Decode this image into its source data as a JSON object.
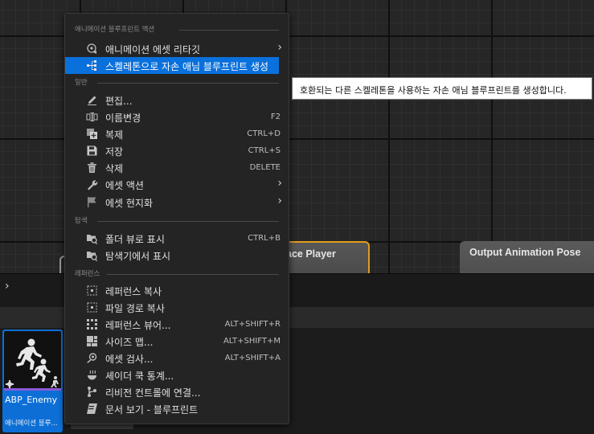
{
  "graph": {
    "nodes": [
      {
        "id": "player",
        "title": "ace Player"
      },
      {
        "id": "output",
        "title": "Output Animation Pose"
      }
    ]
  },
  "breadcrumb": {
    "arrow": "›"
  },
  "asset": {
    "name": "ABP_Enemy",
    "type": "애니메이션 블루...",
    "accent": "#0d6fd6",
    "type_color": "#8a5ad8"
  },
  "context_menu": {
    "sections": [
      {
        "header": "애니메이션 블루프린트 액션"
      },
      {
        "header": "일반"
      },
      {
        "header": "탐색"
      },
      {
        "header": "레퍼런스"
      }
    ],
    "items": [
      {
        "label": "애니메이션 에셋 리타깃",
        "icon": "retarget-icon",
        "submenu": true
      },
      {
        "label": "스켈레톤으로 자손 애님 블루프린트 생성",
        "icon": "skeleton-hierarchy-icon",
        "highlighted": true
      },
      {
        "label": "편집...",
        "icon": "pencil-icon"
      },
      {
        "label": "이름변경",
        "icon": "rename-icon",
        "shortcut": "F2"
      },
      {
        "label": "복제",
        "icon": "duplicate-icon",
        "shortcut": "CTRL+D"
      },
      {
        "label": "저장",
        "icon": "save-icon",
        "shortcut": "CTRL+S"
      },
      {
        "label": "삭제",
        "icon": "trash-icon",
        "shortcut": "DELETE"
      },
      {
        "label": "에셋 액션",
        "icon": "wrench-icon",
        "submenu": true
      },
      {
        "label": "에셋 현지화",
        "icon": "flag-icon",
        "submenu": true
      },
      {
        "label": "폴더 뷰로 표시",
        "icon": "folder-search-icon",
        "shortcut": "CTRL+B"
      },
      {
        "label": "탐색기에서 표시",
        "icon": "explorer-icon"
      },
      {
        "label": "레퍼런스 복사",
        "icon": "copy-reference-icon"
      },
      {
        "label": "파일 경로 복사",
        "icon": "copy-path-icon"
      },
      {
        "label": "레퍼런스 뷰어...",
        "icon": "reference-viewer-icon",
        "shortcut": "ALT+SHIFT+R"
      },
      {
        "label": "사이즈 맵...",
        "icon": "size-map-icon",
        "shortcut": "ALT+SHIFT+M"
      },
      {
        "label": "에셋 검사...",
        "icon": "audit-icon",
        "shortcut": "ALT+SHIFT+A"
      },
      {
        "label": "셰이더 쿡 통계...",
        "icon": "shader-icon"
      },
      {
        "label": "리비전 컨트롤에 연결...",
        "icon": "source-control-icon"
      },
      {
        "label": "문서 보기 - 블루프린트",
        "icon": "documentation-icon"
      }
    ],
    "highlight_color": "#0a70db"
  },
  "tooltip": {
    "text": "호환되는 다른 스켈레톤을 사용하는 자손 애님 블루프린트를 생성합니다."
  }
}
